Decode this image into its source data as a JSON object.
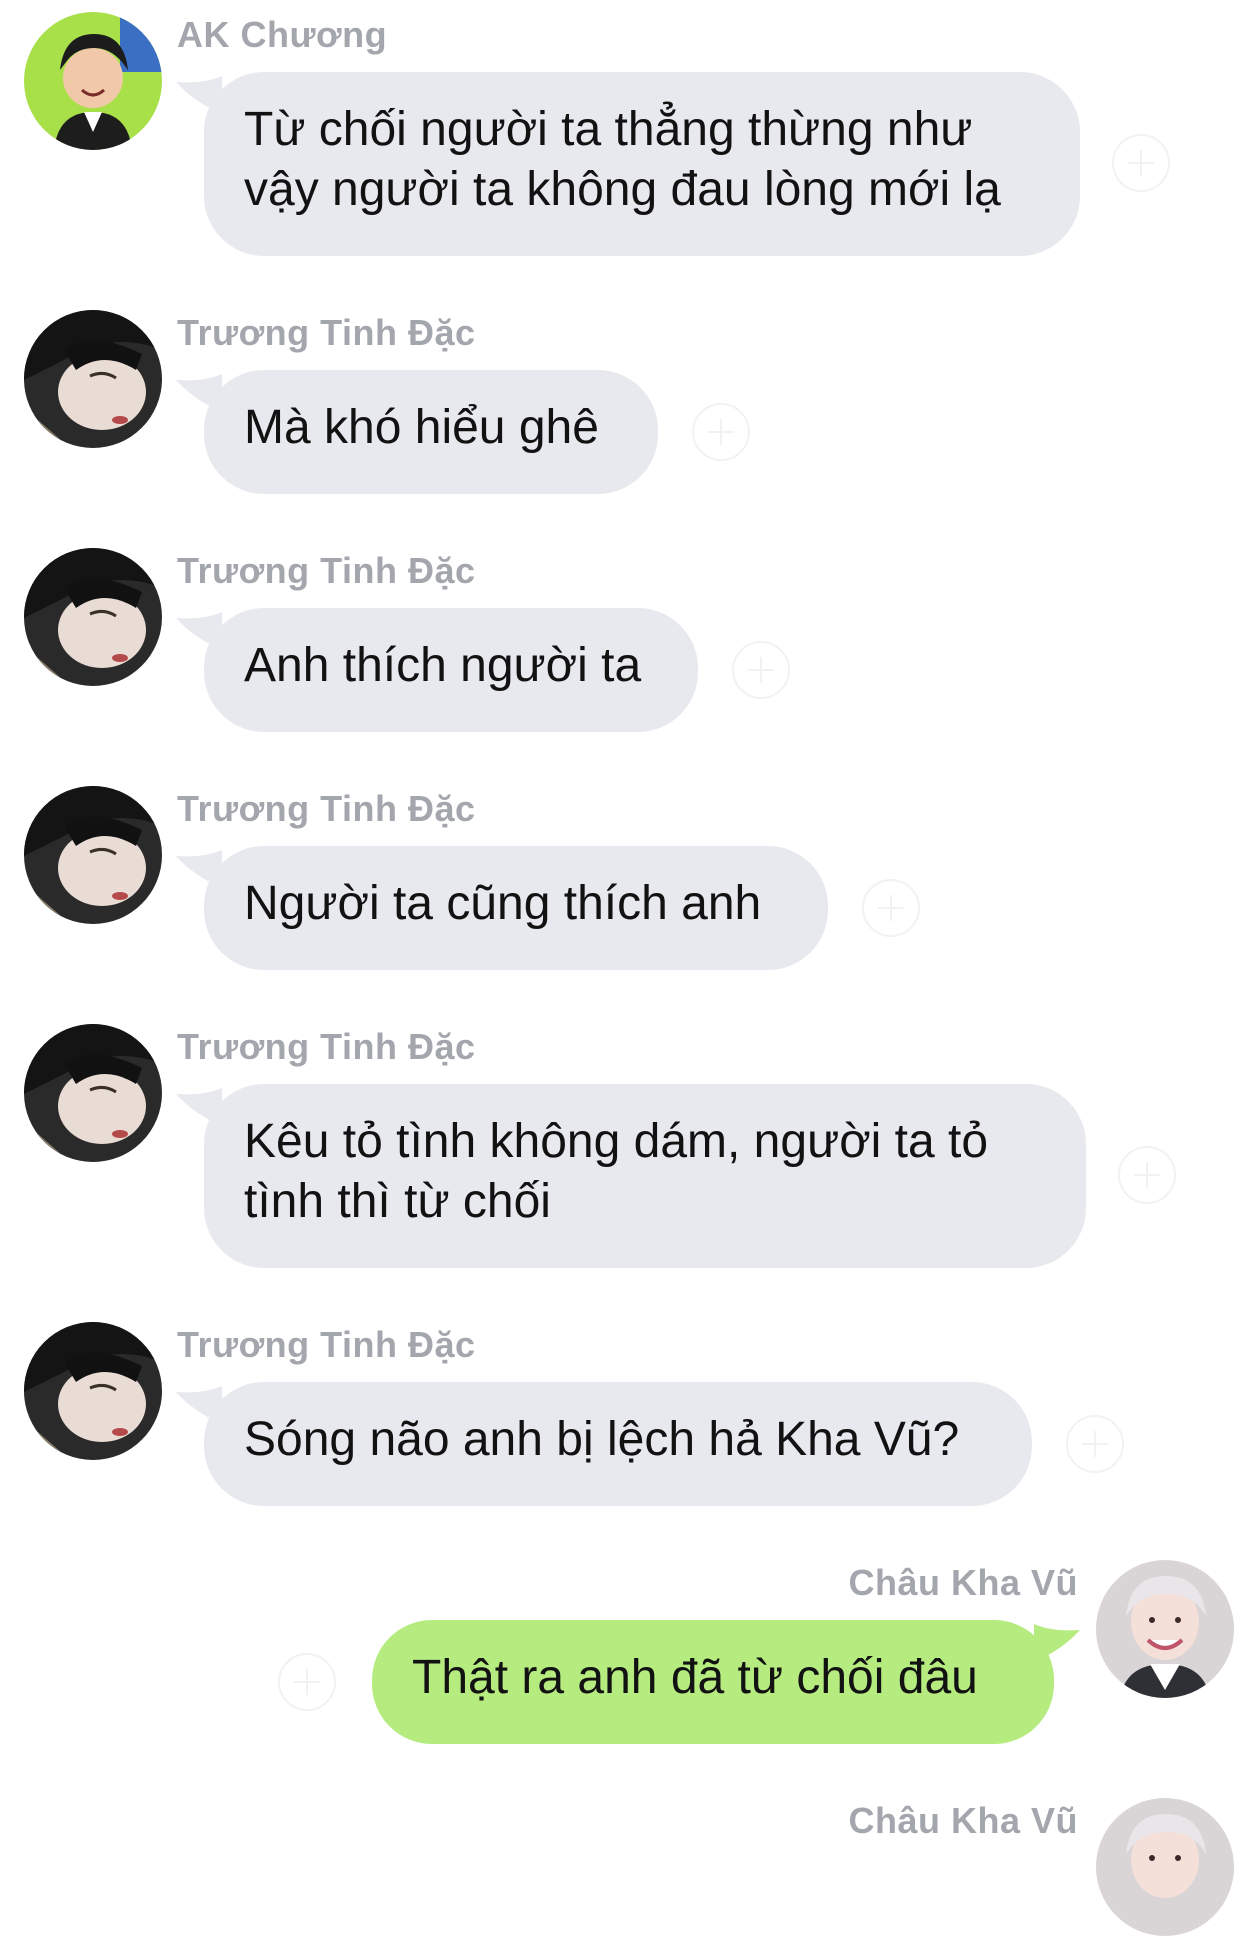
{
  "messages": [
    {
      "sender": "AK Chương",
      "text_lines": [
        "Từ chối người ta thẳng thừng như",
        "vậy người ta không đau lòng mới lạ"
      ],
      "direction": "incoming",
      "avatar_icon": "avatar-ak-chuong"
    },
    {
      "sender": "Trương Tinh Đặc",
      "text_lines": [
        "Mà khó hiểu ghê"
      ],
      "direction": "incoming",
      "avatar_icon": "avatar-truong-tinh-dac"
    },
    {
      "sender": "Trương Tinh Đặc",
      "text_lines": [
        "Anh thích người ta"
      ],
      "direction": "incoming",
      "avatar_icon": "avatar-truong-tinh-dac"
    },
    {
      "sender": "Trương Tinh Đặc",
      "text_lines": [
        "Người ta cũng thích anh"
      ],
      "direction": "incoming",
      "avatar_icon": "avatar-truong-tinh-dac"
    },
    {
      "sender": "Trương Tinh Đặc",
      "text_lines": [
        "Kêu tỏ tình không dám, người ta tỏ",
        "tình thì từ chối"
      ],
      "direction": "incoming",
      "avatar_icon": "avatar-truong-tinh-dac"
    },
    {
      "sender": "Trương Tinh Đặc",
      "text_lines": [
        "Sóng não anh bị lệch hả Kha Vũ?"
      ],
      "direction": "incoming",
      "avatar_icon": "avatar-truong-tinh-dac"
    },
    {
      "sender": "Châu Kha Vũ",
      "text_lines": [
        "Thật ra anh đã từ chối đâu"
      ],
      "direction": "outgoing",
      "avatar_icon": "avatar-chau-kha-vu"
    },
    {
      "sender": "Châu Kha Vũ",
      "text_lines": [],
      "direction": "outgoing",
      "avatar_icon": "avatar-chau-kha-vu"
    }
  ],
  "colors": {
    "incoming_bubble": "#e7e9ee",
    "outgoing_bubble": "#b5eb7f",
    "sender_name": "#a3a6ad",
    "text": "#121212"
  }
}
